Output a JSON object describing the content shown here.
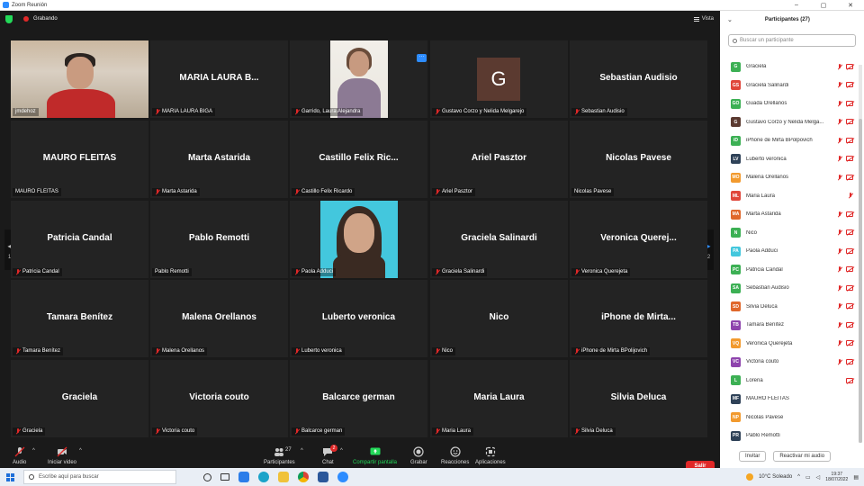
{
  "window": {
    "title": "Zoom Reunión"
  },
  "topbar": {
    "recording": "Grabando",
    "view": "Vista"
  },
  "grid": {
    "tiles": [
      {
        "name": "",
        "label": "jmdehoz",
        "muted": false,
        "video": "red"
      },
      {
        "name": "MARIA LAURA B...",
        "label": "MARIA LAURA BIGA",
        "muted": true
      },
      {
        "name": "",
        "label": "Garrido, Laura Alejandra",
        "muted": true,
        "video": "woman1"
      },
      {
        "name": "",
        "label": "Gustavo Corzo y Nelida Melgarejo",
        "muted": true,
        "avatar": "G"
      },
      {
        "name": "Sebastian Audisio",
        "label": "Sebastian Audisio",
        "muted": true
      },
      {
        "name": "MAURO FLEITAS",
        "label": "MAURO FLEITAS",
        "muted": false
      },
      {
        "name": "Marta Astarida",
        "label": "Marta Astarida",
        "muted": true
      },
      {
        "name": "Castillo Felix Ric...",
        "label": "Castillo Felix Ricardo",
        "muted": true
      },
      {
        "name": "Ariel Pasztor",
        "label": "Ariel Pasztor",
        "muted": true
      },
      {
        "name": "Nicolas Pavese",
        "label": "Nicolas Pavese",
        "muted": false
      },
      {
        "name": "Patricia Candal",
        "label": "Patricia Candal",
        "muted": true
      },
      {
        "name": "Pablo Remotti",
        "label": "Pablo Remotti",
        "muted": false
      },
      {
        "name": "",
        "label": "Paola Adduci",
        "muted": true,
        "video": "woman2"
      },
      {
        "name": "Graciela Salinardi",
        "label": "Graciela Salinardi",
        "muted": true
      },
      {
        "name": "Veronica Querej...",
        "label": "Veronica Querejeta",
        "muted": true
      },
      {
        "name": "Tamara Benítez",
        "label": "Tamara Benítez",
        "muted": true
      },
      {
        "name": "Malena Orellanos",
        "label": "Malena Orellanos",
        "muted": true
      },
      {
        "name": "Luberto veronica",
        "label": "Luberto veronica",
        "muted": true
      },
      {
        "name": "Nico",
        "label": "Nico",
        "muted": true
      },
      {
        "name": "iPhone de Mirta...",
        "label": "iPhone de Mirta BPolijovich",
        "muted": true
      },
      {
        "name": "Graciela",
        "label": "Graciela",
        "muted": true
      },
      {
        "name": "Victoria couto",
        "label": "Victoria couto",
        "muted": true
      },
      {
        "name": "Balcarce german",
        "label": "Balcarce german",
        "muted": true
      },
      {
        "name": "Maria Laura",
        "label": "Maria Laura",
        "muted": true
      },
      {
        "name": "Silvia Deluca",
        "label": "Silvia Deluca",
        "muted": true
      }
    ],
    "pager_left": "1/2",
    "pager_right": "1/2",
    "more_button": "···"
  },
  "toolbar": {
    "audio": "Audio",
    "video": "Iniciar video",
    "participants": "Participantes",
    "participants_count": "27",
    "chat": "Chat",
    "chat_badge": "2",
    "share": "Compartir pantalla",
    "record": "Grabar",
    "reactions": "Reacciones",
    "apps": "Aplicaciones",
    "leave": "Salir"
  },
  "panel": {
    "title": "Participantes (27)",
    "search_placeholder": "Buscar un participante",
    "items": [
      {
        "initials": "G",
        "name": "Graciela",
        "color": "#3cb054",
        "mic": true,
        "vid": true
      },
      {
        "initials": "GS",
        "name": "Graciela Salinardi",
        "color": "#e0463a",
        "mic": true,
        "vid": true
      },
      {
        "initials": "GO",
        "name": "Guada Orellanos",
        "color": "#3cb054",
        "mic": true,
        "vid": true
      },
      {
        "initials": "G",
        "name": "Gustavo Corzo y Nelida Melga...",
        "color": "#5b3a30",
        "mic": true,
        "vid": true
      },
      {
        "initials": "iD",
        "name": "iPhone de Mirta BPolpovich",
        "color": "#3cb054",
        "mic": true,
        "vid": true
      },
      {
        "initials": "LV",
        "name": "Luberto veronica",
        "color": "#2f4258",
        "mic": true,
        "vid": true
      },
      {
        "initials": "MO",
        "name": "Malena Orellanos",
        "color": "#f29a2e",
        "mic": true,
        "vid": true
      },
      {
        "initials": "ML",
        "name": "Maria Laura",
        "color": "#e0463a",
        "mic": true,
        "vid": false
      },
      {
        "initials": "MA",
        "name": "Marta Astarida",
        "color": "#e0672a",
        "mic": true,
        "vid": true
      },
      {
        "initials": "N",
        "name": "Nico",
        "color": "#3cb054",
        "mic": true,
        "vid": true
      },
      {
        "initials": "PA",
        "name": "Paola Adduci",
        "color": "#43c7dd",
        "mic": true,
        "vid": true
      },
      {
        "initials": "PC",
        "name": "Patricia Candal",
        "color": "#3cb054",
        "mic": true,
        "vid": true
      },
      {
        "initials": "SA",
        "name": "Sebastian Audisio",
        "color": "#3cb054",
        "mic": true,
        "vid": true
      },
      {
        "initials": "SD",
        "name": "Silvia Deluca",
        "color": "#e0672a",
        "mic": true,
        "vid": true
      },
      {
        "initials": "TB",
        "name": "Tamara Benítez",
        "color": "#8e44ad",
        "mic": true,
        "vid": true
      },
      {
        "initials": "VQ",
        "name": "Veronica Querejeta",
        "color": "#f29a2e",
        "mic": true,
        "vid": true
      },
      {
        "initials": "VC",
        "name": "Victoria couto",
        "color": "#8e44ad",
        "mic": true,
        "vid": true
      },
      {
        "initials": "L",
        "name": "Lorena",
        "color": "#3cb054",
        "mic": false,
        "vid": true
      },
      {
        "initials": "MF",
        "name": "MAURO FLEITAS",
        "color": "#2f4258",
        "mic": false,
        "vid": false
      },
      {
        "initials": "NP",
        "name": "Nicolas Pavese",
        "color": "#f29a2e",
        "mic": false,
        "vid": false
      },
      {
        "initials": "PR",
        "name": "Pablo Remotti",
        "color": "#2f4258",
        "mic": false,
        "vid": false
      }
    ],
    "invite": "Invitar",
    "reactivate_audio": "Reactivar mi audio"
  },
  "taskbar": {
    "search": "Escribe aquí para buscar",
    "weather": "10°C  Soleado",
    "time": "19:37",
    "date": "18/07/2022"
  }
}
